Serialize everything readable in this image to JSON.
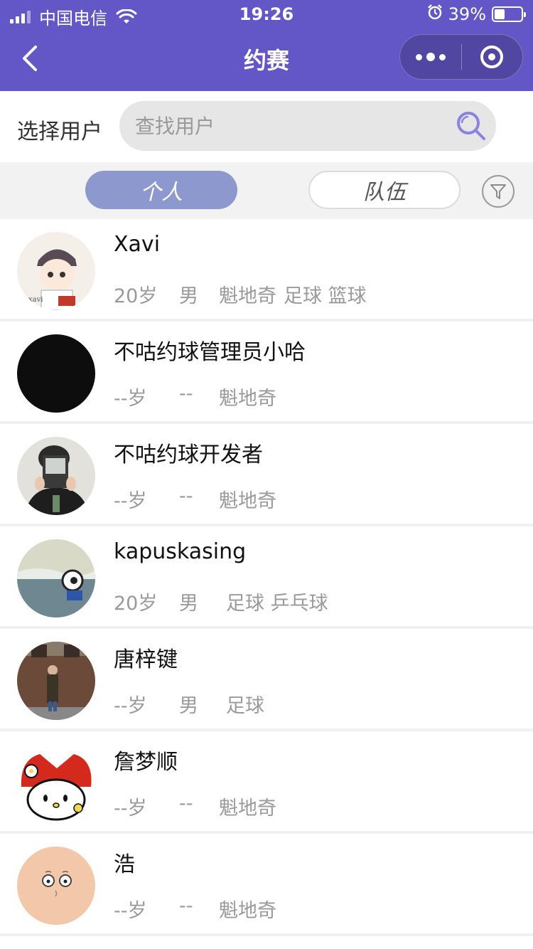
{
  "status_bar": {
    "carrier": "中国电信",
    "time": "19:26",
    "battery": "39%",
    "battery_level": 0.39
  },
  "navbar": {
    "title": "约赛"
  },
  "search": {
    "label": "选择用户",
    "placeholder": "查找用户"
  },
  "tabs": [
    {
      "label": "个人",
      "active": true
    },
    {
      "label": "队伍",
      "active": false
    }
  ],
  "users": [
    {
      "name": "Xavi",
      "age": "20岁",
      "gender": "男",
      "location": "魁地奇",
      "sports": "足球 篮球"
    },
    {
      "name": "不咕约球管理员小哈",
      "age": "--岁",
      "gender": "--",
      "location": "魁地奇",
      "sports": ""
    },
    {
      "name": "不咕约球开发者",
      "age": "--岁",
      "gender": "--",
      "location": "魁地奇",
      "sports": ""
    },
    {
      "name": "kapuskasing",
      "age": "20岁",
      "gender": "男",
      "location": "",
      "sports": "足球 乒乓球"
    },
    {
      "name": "唐梓键",
      "age": "--岁",
      "gender": "男",
      "location": "",
      "sports": "足球"
    },
    {
      "name": "詹梦顺",
      "age": "--岁",
      "gender": "--",
      "location": "魁地奇",
      "sports": ""
    },
    {
      "name": "浩",
      "age": "--岁",
      "gender": "--",
      "location": "魁地奇",
      "sports": ""
    }
  ],
  "colors": {
    "header": "#6356c6",
    "tab_active": "#8d98cf",
    "search_icon": "#8a83e0"
  }
}
